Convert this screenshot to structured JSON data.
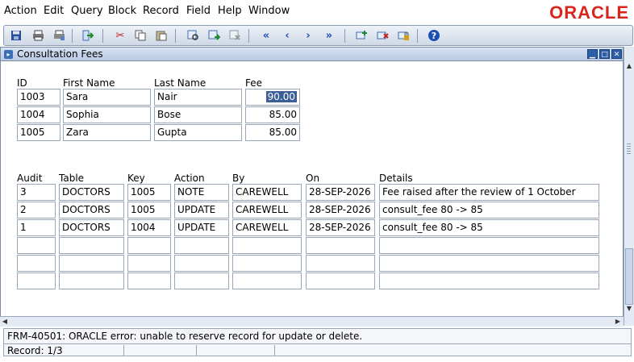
{
  "menu": {
    "items": [
      "Action",
      "Edit",
      "Query",
      "Block",
      "Record",
      "Field",
      "Help",
      "Window"
    ],
    "logo": "ORACLE"
  },
  "colors": {
    "logo": "#d9261c",
    "toolbar_icon_blue": "#1e4fb3",
    "selected_field": "#3b5f96"
  },
  "toolbar": {
    "icons": [
      "save-icon",
      "print-icon",
      "print-setup-icon",
      "exit-icon",
      "cut-icon",
      "copy-icon",
      "paste-icon",
      "enter-query-icon",
      "execute-query-icon",
      "cancel-query-icon",
      "first-record-icon",
      "previous-record-icon",
      "next-record-icon",
      "last-record-icon",
      "insert-record-icon",
      "delete-record-icon",
      "lock-record-icon",
      "help-icon"
    ]
  },
  "window": {
    "title": "Consultation Fees",
    "controls": [
      "minimize",
      "maximize",
      "close"
    ]
  },
  "fees": {
    "headers": {
      "id": "ID",
      "first": "First Name",
      "last": "Last Name",
      "fee": "Fee"
    },
    "rows": [
      {
        "id": "1003",
        "first": "Sara",
        "last": "Nair",
        "fee": "90.00"
      },
      {
        "id": "1004",
        "first": "Sophia",
        "last": "Bose",
        "fee": "85.00"
      },
      {
        "id": "1005",
        "first": "Zara",
        "last": "Gupta",
        "fee": "85.00"
      }
    ]
  },
  "audit": {
    "headers": {
      "audit": "Audit",
      "table": "Table",
      "key": "Key",
      "action": "Action",
      "by": "By",
      "on": "On",
      "details": "Details"
    },
    "rows": [
      {
        "audit": "3",
        "table": "DOCTORS",
        "key": "1005",
        "action": "NOTE",
        "by": "CAREWELL",
        "on": "28-SEP-2026",
        "details": "Fee raised after the review of 1 October"
      },
      {
        "audit": "2",
        "table": "DOCTORS",
        "key": "1005",
        "action": "UPDATE",
        "by": "CAREWELL",
        "on": "28-SEP-2026",
        "details": "consult_fee 80 -> 85"
      },
      {
        "audit": "1",
        "table": "DOCTORS",
        "key": "1004",
        "action": "UPDATE",
        "by": "CAREWELL",
        "on": "28-SEP-2026",
        "details": "consult_fee 80 -> 85"
      },
      {
        "audit": "",
        "table": "",
        "key": "",
        "action": "",
        "by": "",
        "on": "",
        "details": ""
      },
      {
        "audit": "",
        "table": "",
        "key": "",
        "action": "",
        "by": "",
        "on": "",
        "details": ""
      },
      {
        "audit": "",
        "table": "",
        "key": "",
        "action": "",
        "by": "",
        "on": "",
        "details": ""
      }
    ]
  },
  "status": {
    "message": "FRM-40501: ORACLE error: unable to reserve record for update or delete.",
    "record": "Record: 1/3"
  }
}
